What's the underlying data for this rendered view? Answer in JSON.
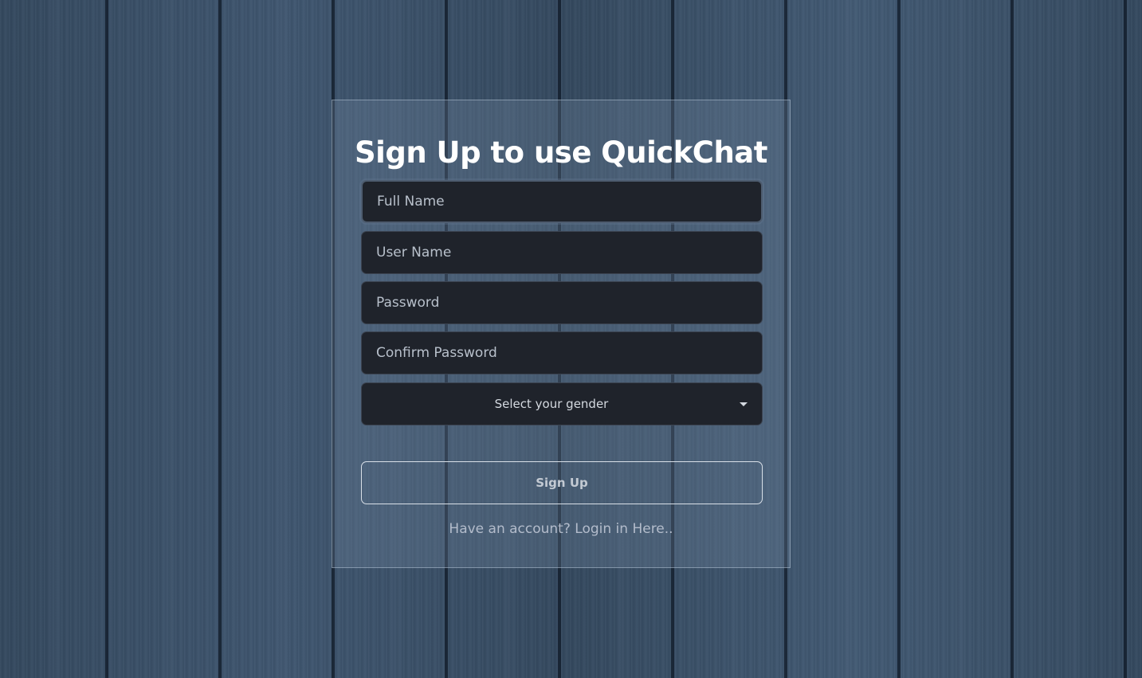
{
  "page": {
    "title": "Sign Up to use QuickChat"
  },
  "form": {
    "full_name_placeholder": "Full Name",
    "user_name_placeholder": "User Name",
    "password_placeholder": "Password",
    "confirm_password_placeholder": "Confirm Password",
    "gender_select": {
      "selected": "Select your gender",
      "icon": "chevron-down-icon"
    },
    "submit_label": "Sign Up",
    "login_link": "Have an account? Login in Here.."
  },
  "colors": {
    "background": "#3a5068",
    "input_bg": "#1f232b",
    "title": "#ffffff"
  }
}
